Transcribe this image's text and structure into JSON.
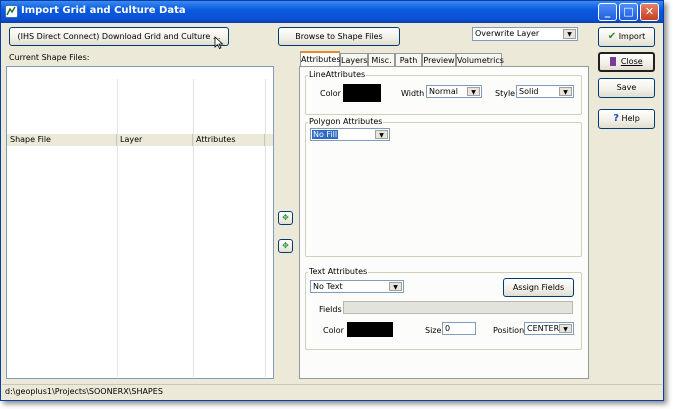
{
  "window": {
    "title": "Import Grid and Culture Data",
    "controls": {
      "minimize": "_",
      "maximize": "□",
      "close": "✕"
    }
  },
  "toolbar": {
    "download_button": "(IHS  Direct Connect) Download Grid and Culture ...",
    "browse_button": "Browse to Shape Files",
    "mode_select": "Overwrite Layer"
  },
  "actions": {
    "import": "Import",
    "close": "Close",
    "save": "Save",
    "help": "Help"
  },
  "shape_files": {
    "heading": "Current Shape Files:",
    "columns": [
      "Shape File",
      "Layer",
      "Attributes"
    ],
    "rows": []
  },
  "tabs": [
    "Attributes",
    "Layers",
    "Misc.",
    "Path",
    "Preview",
    "Volumetrics"
  ],
  "active_tab": "Attributes",
  "line_attributes": {
    "title": "LineAttributes",
    "color_label": "Color",
    "color": "#000000",
    "width_label": "Width",
    "width_value": "Normal",
    "style_label": "Style",
    "style_value": "Solid"
  },
  "polygon_attributes": {
    "title": "Polygon Attributes",
    "fill_value": "No Fill"
  },
  "text_attributes": {
    "title": "Text Attributes",
    "text_value": "No Text",
    "assign_button": "Assign Fields",
    "fields_label": "Fields",
    "fields_value": "",
    "color_label": "Color",
    "color": "#000000",
    "size_label": "Size",
    "size_value": "0",
    "position_label": "Position",
    "position_value": "CENTER"
  },
  "statusbar": {
    "path": "d:\\geoplus1\\Projects\\SOONERX\\SHAPES"
  },
  "icons": {
    "move_up": "up-arrow-icon",
    "move_down": "down-arrow-icon",
    "import": "checkmark-icon",
    "close": "door-icon",
    "help": "question-icon"
  },
  "colors": {
    "titlebar": "#0a5ae0",
    "accent_green": "#2e8b3a",
    "tab_highlight": "#e68b2c"
  }
}
